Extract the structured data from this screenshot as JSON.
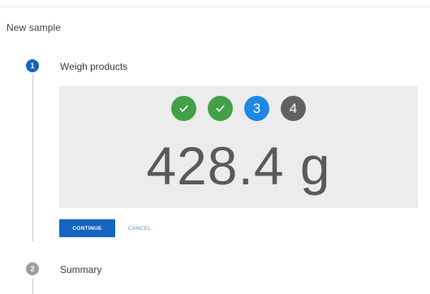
{
  "dialog": {
    "title": "New sample"
  },
  "steps": [
    {
      "number": "1",
      "label": "Weigh products",
      "state": "active"
    },
    {
      "number": "2",
      "label": "Summary",
      "state": "inactive"
    }
  ],
  "weighing": {
    "progress": [
      {
        "label": "",
        "state": "done",
        "icon": "check-icon"
      },
      {
        "label": "",
        "state": "done",
        "icon": "check-icon"
      },
      {
        "label": "3",
        "state": "current"
      },
      {
        "label": "4",
        "state": "pending"
      }
    ],
    "weight_display": "428.4 g"
  },
  "actions": {
    "continue_label": "CONTINUE",
    "cancel_label": "CANCEL"
  },
  "colors": {
    "primary": "#1565c0",
    "done": "#43a047",
    "current": "#1e88e5",
    "pending": "#616161",
    "panel": "#ececec"
  }
}
